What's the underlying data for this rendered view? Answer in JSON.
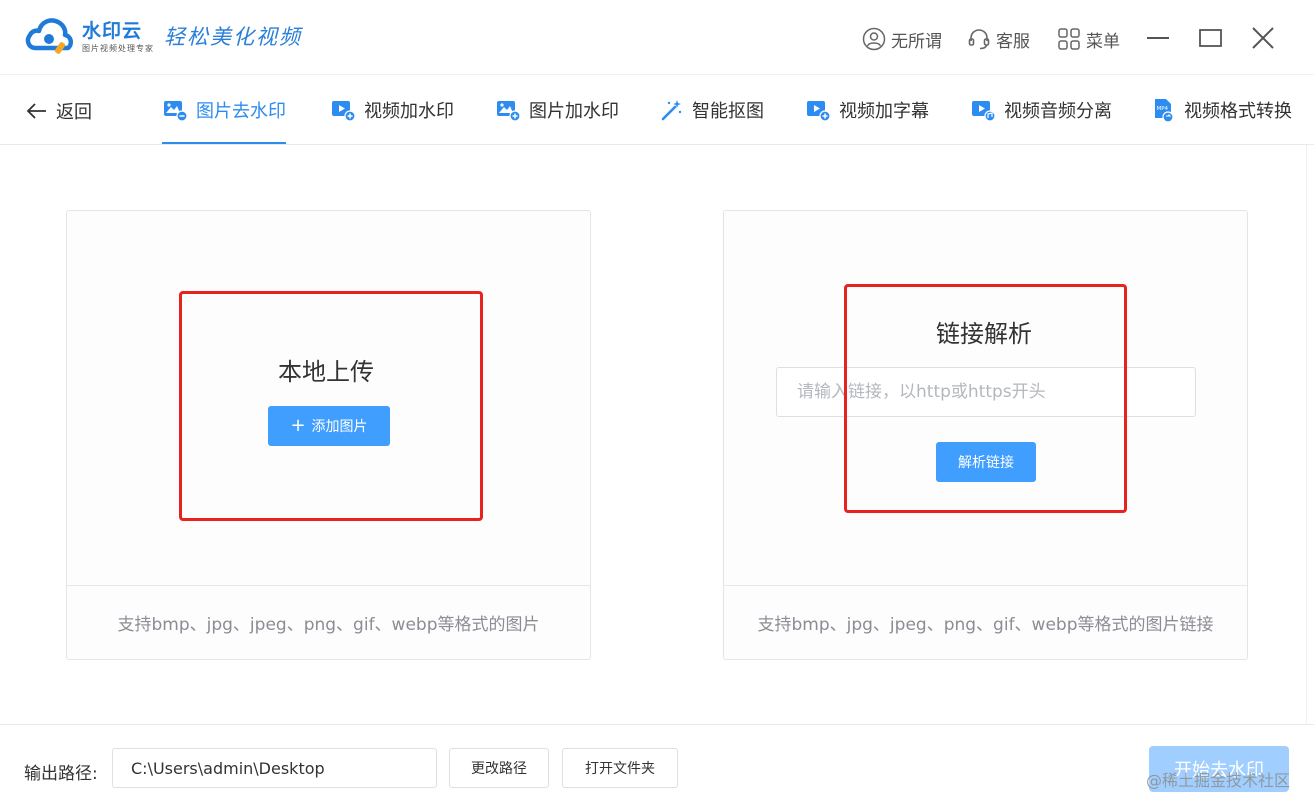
{
  "app": {
    "brand_name": "水印云",
    "brand_sub": "图片视频处理专家",
    "slogan": "轻松美化视频"
  },
  "titlebar": {
    "user_label": "无所谓",
    "service_label": "客服",
    "menu_label": "菜单"
  },
  "nav": {
    "back_label": "返回",
    "tabs": [
      {
        "label": "图片去水印",
        "icon": "image-remove-icon",
        "active": true
      },
      {
        "label": "视频加水印",
        "icon": "video-add-icon",
        "active": false
      },
      {
        "label": "图片加水印",
        "icon": "image-add-icon",
        "active": false
      },
      {
        "label": "智能抠图",
        "icon": "magic-wand-icon",
        "active": false
      },
      {
        "label": "视频加字幕",
        "icon": "video-subtitle-icon",
        "active": false
      },
      {
        "label": "视频音频分离",
        "icon": "video-audio-icon",
        "active": false
      },
      {
        "label": "视频格式转换",
        "icon": "mp4-convert-icon",
        "active": false
      }
    ]
  },
  "local_upload": {
    "title": "本地上传",
    "button_label": "添加图片",
    "footer_note": "支持bmp、jpg、jpeg、png、gif、webp等格式的图片"
  },
  "link_parse": {
    "title": "链接解析",
    "input_placeholder": "请输入链接，以http或https开头",
    "input_value": "",
    "button_label": "解析链接",
    "footer_note": "支持bmp、jpg、jpeg、png、gif、webp等格式的图片链接"
  },
  "output": {
    "label": "输出路径:",
    "path": "C:\\Users\\admin\\Desktop",
    "change_label": "更改路径",
    "open_label": "打开文件夹",
    "start_label": "开始去水印"
  },
  "watermark_text": "@稀土掘金技术社区",
  "colors": {
    "accent": "#2d8cf0",
    "button_blue": "#409eff",
    "button_disabled": "#a0cfff",
    "highlight_red": "#e8231f"
  }
}
